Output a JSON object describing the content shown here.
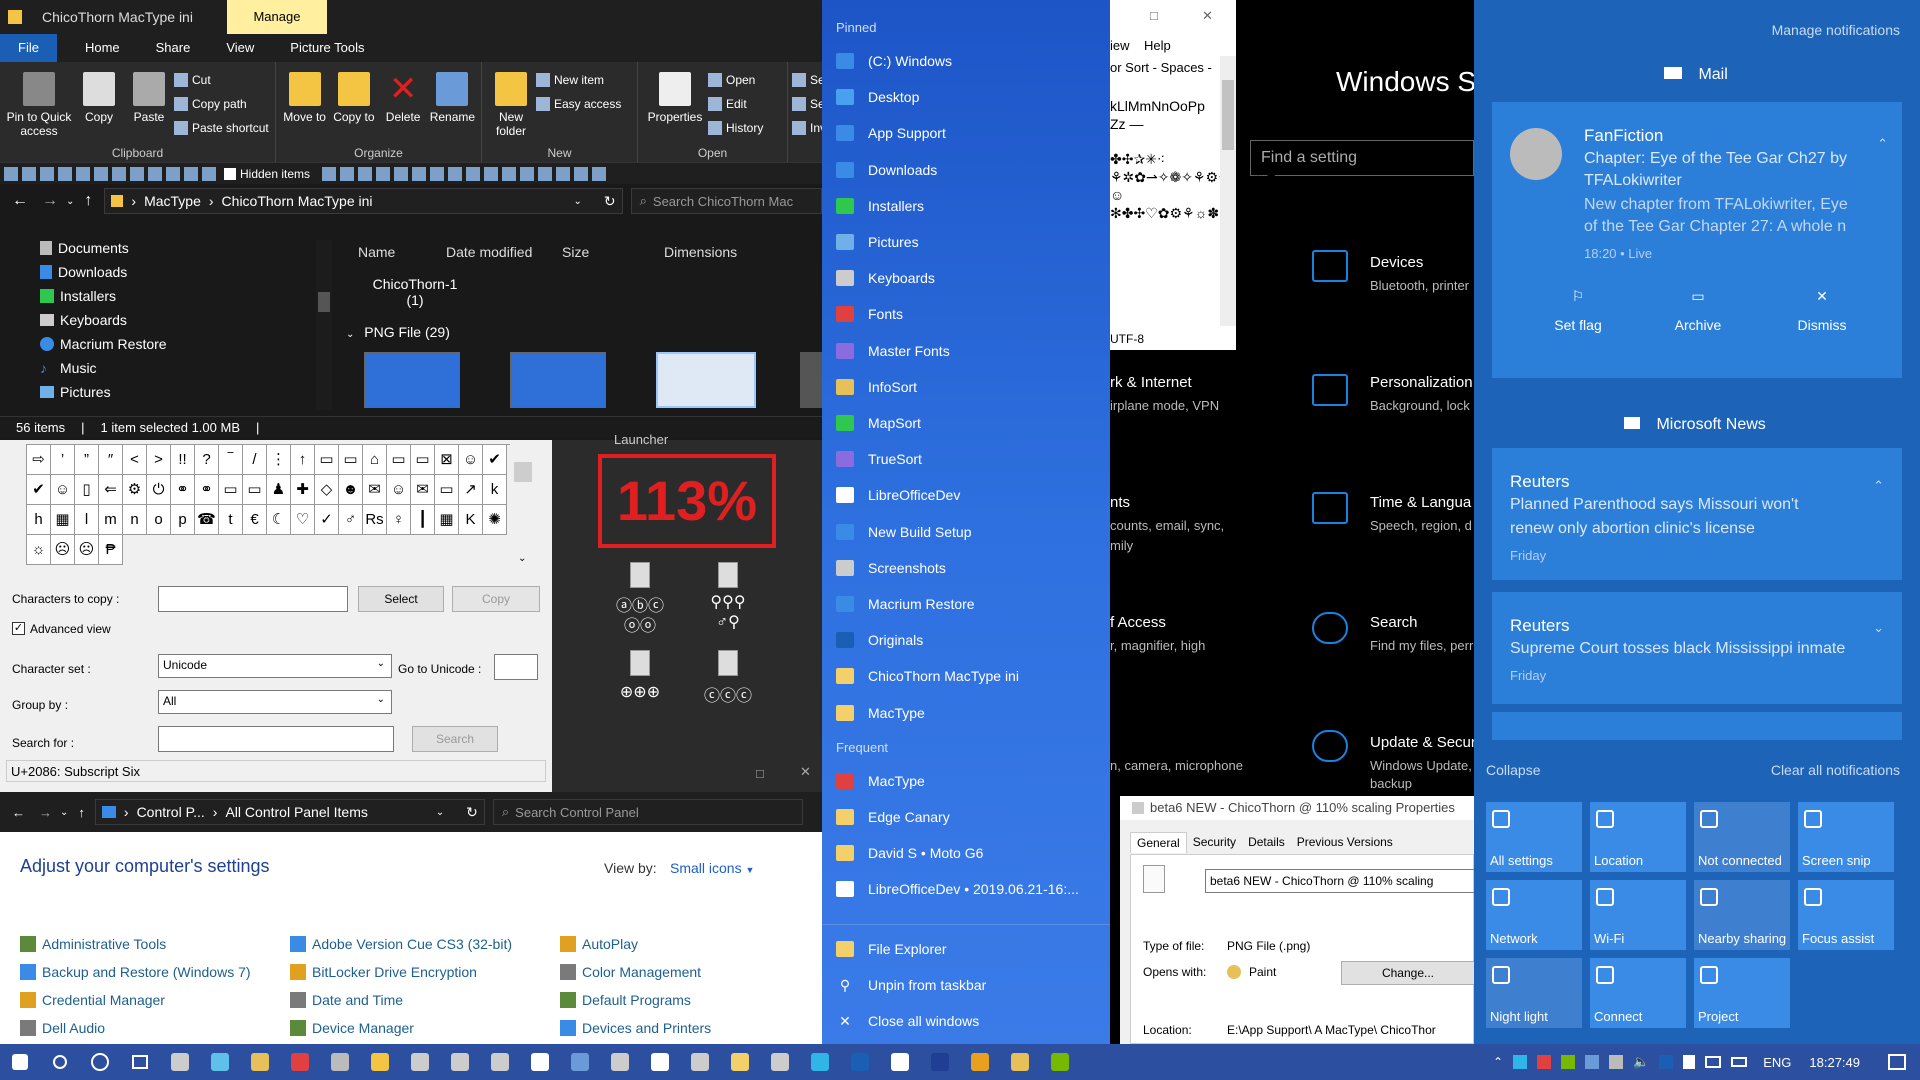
{
  "explorer": {
    "title": "ChicoThorn MacType ini",
    "manage_tab": "Manage",
    "ribbon_tabs": [
      "File",
      "Home",
      "Share",
      "View",
      "Picture Tools"
    ],
    "clipboard": {
      "pin": "Pin to Quick access",
      "copy": "Copy",
      "paste": "Paste",
      "cut": "Cut",
      "copy_path": "Copy path",
      "paste_shortcut": "Paste shortcut",
      "label": "Clipboard"
    },
    "organize": {
      "move_to": "Move to",
      "copy_to": "Copy to",
      "delete": "Delete",
      "rename": "Rename",
      "label": "Organize"
    },
    "new": {
      "new_folder": "New folder",
      "new_item": "New item",
      "easy_access": "Easy access",
      "label": "New"
    },
    "open": {
      "properties": "Properties",
      "open": "Open",
      "edit": "Edit",
      "history": "History",
      "label": "Open"
    },
    "select": {
      "a": "Sele",
      "b": "Sele",
      "c": "Inve"
    },
    "qat_hidden": "Hidden items",
    "breadcrumb": [
      "MacType",
      "ChicoThorn MacType ini"
    ],
    "search_placeholder": "Search ChicoThorn Mac",
    "nav_items": [
      "Documents",
      "Downloads",
      "Installers",
      "Keyboards",
      "Macrium Restore",
      "Music",
      "Pictures"
    ],
    "columns": [
      "Name",
      "Date modified",
      "Size",
      "Dimensions"
    ],
    "folder_item": "ChicoThorn-1",
    "folder_count": "(1)",
    "group_header": "PNG File (29)",
    "status": {
      "items": "56 items",
      "selected": "1 item selected  1.00 MB"
    }
  },
  "charmap": {
    "chars": [
      "⇨",
      "’",
      "”",
      "″",
      "<",
      ">",
      "!!",
      "?",
      "‾",
      "/",
      "⋮",
      "↑",
      "▭",
      "▭",
      "⌂",
      "▭",
      "▭",
      "⊠",
      "☺",
      "✔",
      "✔",
      "☺",
      "▯",
      "⇐",
      "⚙",
      "⏻",
      "⚭",
      "⚭",
      "▭",
      "▭",
      "♟",
      "✚",
      "◇",
      "☻",
      "✉",
      "☺",
      "✉",
      "▭",
      "↗",
      "k",
      "h",
      "▦",
      "l",
      "m",
      "n",
      "o",
      "p",
      "☎",
      "t",
      "€",
      "☾",
      "♡",
      "✓",
      "♂",
      "Rs",
      "♀",
      "┃",
      "▦",
      "K",
      "✺",
      "☼",
      "☹",
      "☹",
      "₱"
    ],
    "chars_to_copy_label": "Characters to copy :",
    "select_btn": "Select",
    "copy_btn": "Copy",
    "advanced_view": "Advanced view",
    "charset_label": "Character set :",
    "charset_value": "Unicode",
    "goto_label": "Go to Unicode :",
    "groupby_label": "Group by :",
    "groupby_value": "All",
    "searchfor_label": "Search for :",
    "search_btn": "Search",
    "status": "U+2086: Subscript Six"
  },
  "launcher": {
    "title": "Launcher",
    "zoom": "113%",
    "glyph_rows": [
      "ⓐⓑⓒ",
      "⚲⚲⚲",
      "ⓞⓞ",
      "♂⚲",
      "⊕⊕⊕",
      "ⓒⓒⓒ"
    ]
  },
  "control_panel": {
    "breadcrumb": [
      "Control P...",
      "All Control Panel Items"
    ],
    "search_placeholder": "Search Control Panel",
    "heading": "Adjust your computer's settings",
    "view_by_label": "View by:",
    "view_by_value": "Small icons",
    "items": [
      [
        "Administrative Tools",
        "Backup and Restore (Windows 7)",
        "Credential Manager",
        "Dell Audio"
      ],
      [
        "Adobe Version Cue CS3 (32-bit)",
        "BitLocker Drive Encryption",
        "Date and Time",
        "Device Manager"
      ],
      [
        "AutoPlay",
        "Color Management",
        "Default Programs",
        "Devices and Printers"
      ]
    ]
  },
  "jump_list": {
    "pinned_label": "Pinned",
    "pinned": [
      "(C:) Windows",
      "Desktop",
      "App Support",
      "Downloads",
      "Installers",
      "Pictures",
      "Keyboards",
      "Fonts",
      "Master Fonts",
      "InfoSort",
      "MapSort",
      "TrueSort",
      "LibreOfficeDev",
      "New Build Setup",
      "Screenshots",
      "Macrium Restore",
      "Originals",
      "ChicoThorn MacType ini",
      "MacType"
    ],
    "frequent_label": "Frequent",
    "frequent": [
      "MacType",
      "Edge Canary",
      "David S • Moto G6",
      "LibreOfficeDev • 2019.06.21-16:..."
    ],
    "actions": [
      "File Explorer",
      "Unpin from taskbar",
      "Close all windows"
    ]
  },
  "editor": {
    "menu_help": "Help",
    "menu_view": "iew",
    "toolbar": "or Sort - Spaces -",
    "line1": "kLlMmNnOoPp",
    "line2": "Zz —",
    "encoding": "UTF-8"
  },
  "settings": {
    "title": "Windows Se",
    "find_placeholder": "Find a setting",
    "items": [
      {
        "name": "Devices",
        "desc": "Bluetooth, printer"
      },
      {
        "name": "rk & Internet",
        "desc": "irplane mode, VPN"
      },
      {
        "name": "Personalization",
        "desc": "Background, lock"
      },
      {
        "name": "nts",
        "desc": "counts, email, sync,"
      },
      {
        "name": "",
        "desc": "mily"
      },
      {
        "name": "Time & Langua",
        "desc": "Speech, region, d"
      },
      {
        "name": "f Access",
        "desc": "r, magnifier, high"
      },
      {
        "name": "Search",
        "desc": "Find my files, perr"
      },
      {
        "name": "",
        "desc": "n, camera, microphone"
      },
      {
        "name": "Update & Secur",
        "desc": "Windows Update,"
      },
      {
        "name": "",
        "desc": "backup"
      }
    ]
  },
  "properties": {
    "title": "beta6 NEW - ChicoThorn @ 110% scaling Properties",
    "tabs": [
      "General",
      "Security",
      "Details",
      "Previous Versions"
    ],
    "filename": "beta6 NEW - ChicoThorn @ 110% scaling",
    "type_label": "Type of file:",
    "type_value": "PNG File (.png)",
    "opens_label": "Opens with:",
    "opens_value": "Paint",
    "change_btn": "Change...",
    "location_label": "Location:",
    "location_value": "E:\\App Support\\ A MacType\\ ChicoThor"
  },
  "action_center": {
    "manage": "Manage notifications",
    "mail_header": "Mail",
    "mail_card": {
      "title": "FanFiction",
      "line1": "Chapter: Eye of the Tee Gar Ch27 by",
      "line2": "TFALokiwriter",
      "line3": "New chapter from TFALokiwriter, Eye",
      "line4": "of the Tee Gar Chapter 27: A whole n",
      "time": "18:20 • Live"
    },
    "mail_actions": [
      "Set flag",
      "Archive",
      "Dismiss"
    ],
    "news_header": "Microsoft News",
    "news": [
      {
        "source": "Reuters",
        "line1": "Planned Parenthood says Missouri won't",
        "line2": "renew only abortion clinic's license",
        "time": "Friday"
      },
      {
        "source": "Reuters",
        "line1": "Supreme Court tosses black Mississippi inmate",
        "line2": "",
        "time": "Friday"
      }
    ],
    "collapse": "Collapse",
    "clear_all": "Clear all notifications",
    "tiles": [
      "All settings",
      "Location",
      "Not connected",
      "Screen snip",
      "Network",
      "Wi-Fi",
      "Nearby sharing",
      "Focus assist",
      "Night light",
      "Connect",
      "Project"
    ]
  },
  "taskbar": {
    "lang": "ENG",
    "time": "18:27:49"
  }
}
